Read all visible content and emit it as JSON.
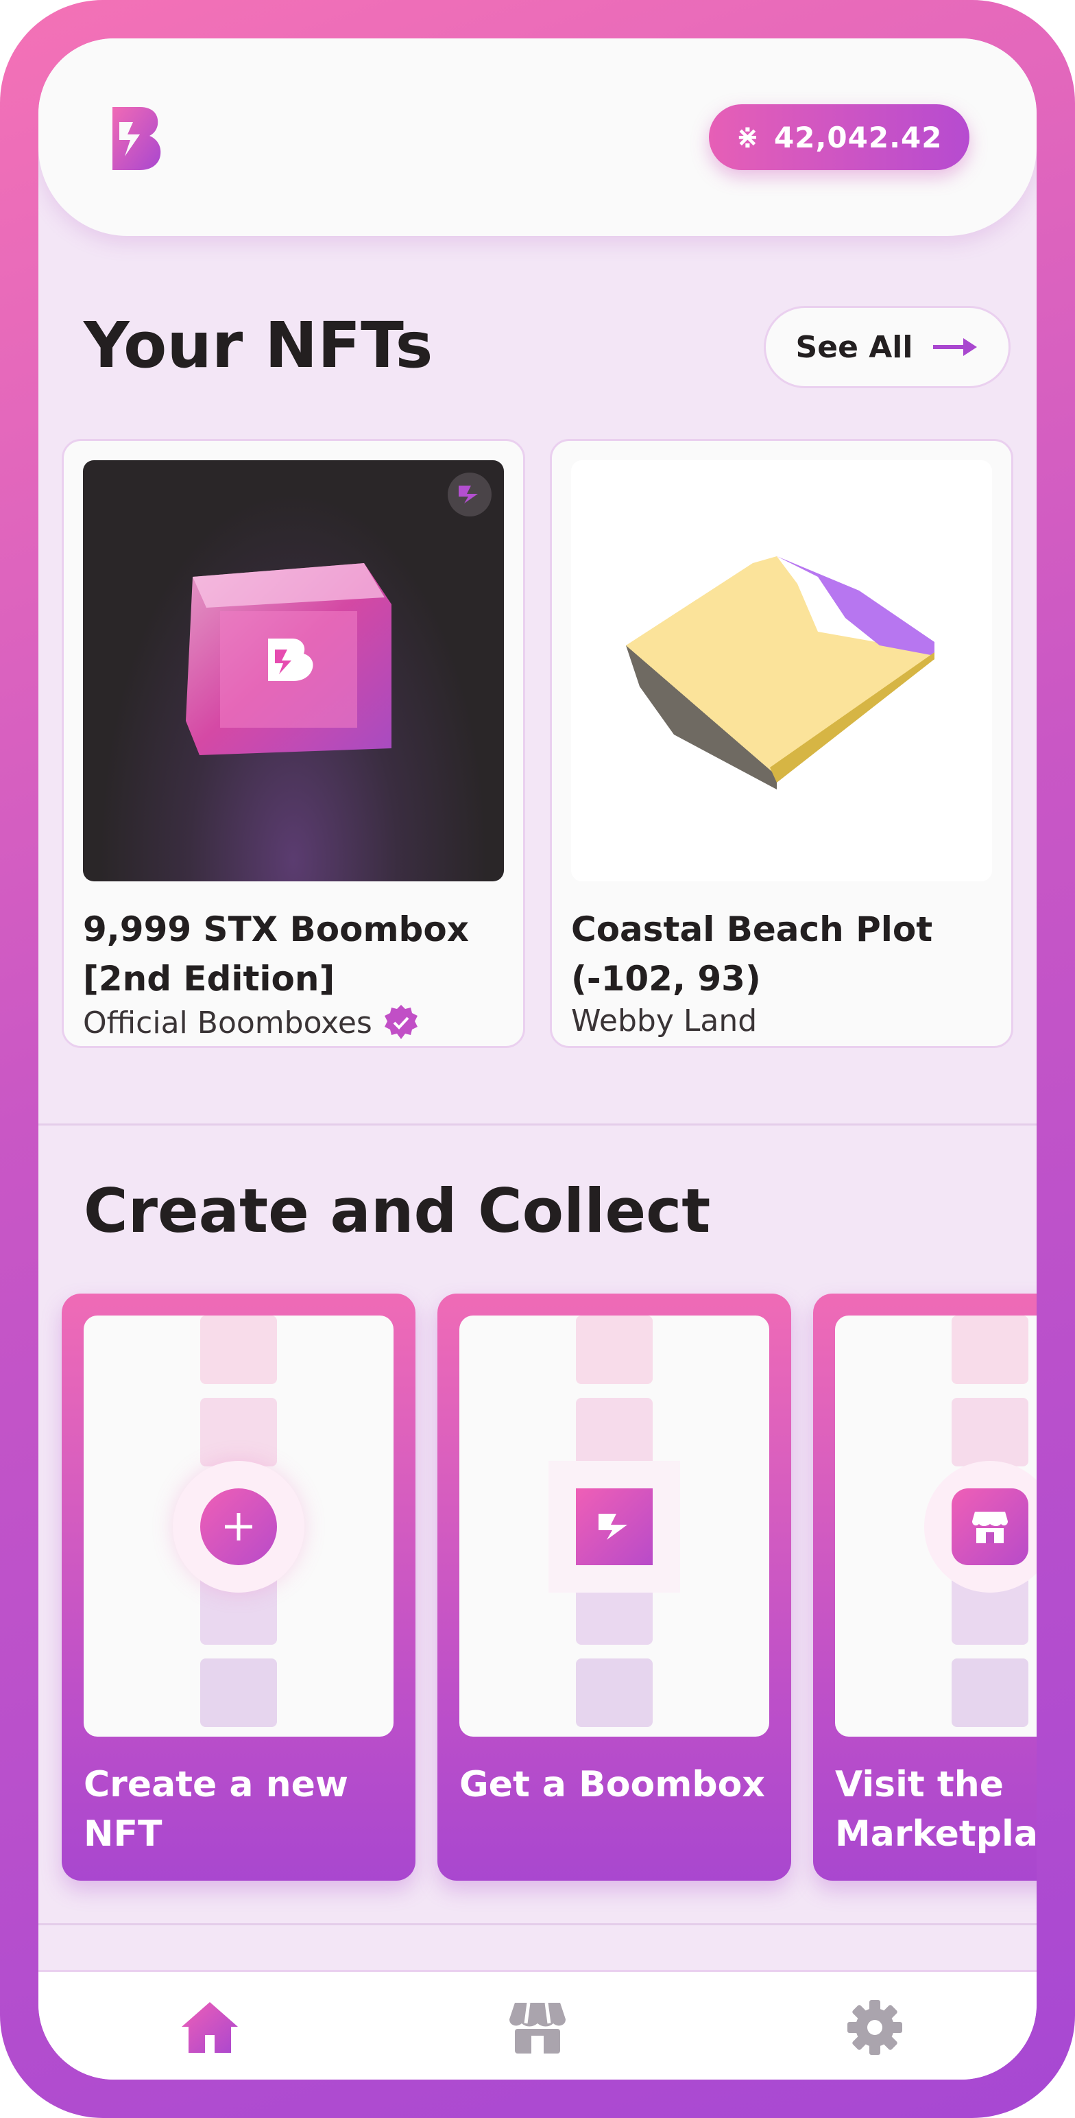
{
  "header": {
    "balance": {
      "symbol": "͞✕",
      "symbol_text": "⋇",
      "amount": "42,042.42"
    },
    "accent_gradient": [
      "#f472b6",
      "#a748d3"
    ]
  },
  "your_nfts": {
    "title": "Your NFTs",
    "see_all_label": "See All",
    "items": [
      {
        "name": "9,999 STX Boombox [2nd Edition]",
        "collection": "Official Boomboxes",
        "verified": true
      },
      {
        "name": "Coastal Beach Plot (-102, 93)",
        "collection": "Webby Land",
        "verified": false
      }
    ]
  },
  "create_collect": {
    "title": "Create and Collect",
    "cards": [
      {
        "label": "Create a new NFT",
        "icon": "plus-icon"
      },
      {
        "label": "Get a Boombox",
        "icon": "boombox-icon"
      },
      {
        "label": "Visit the Marketplace",
        "icon": "store-icon"
      }
    ]
  },
  "nav": {
    "items": [
      {
        "icon": "home-icon",
        "active": true
      },
      {
        "icon": "store-icon",
        "active": false
      },
      {
        "icon": "gear-icon",
        "active": false
      }
    ],
    "active_color": "#b84bc9",
    "inactive_color": "#aaa4ad"
  }
}
